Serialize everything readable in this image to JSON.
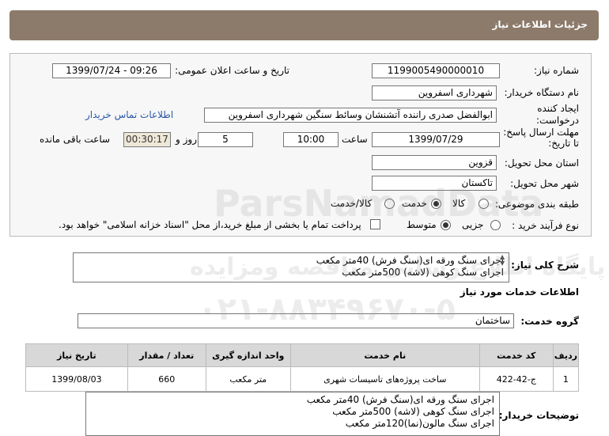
{
  "page_title": "جزئیات اطلاعات نیاز",
  "fields": {
    "need_number_label": "شماره نیاز:",
    "need_number": "1199005490000010",
    "announce_label": "تاریخ و ساعت اعلان عمومی:",
    "announce_value": "1399/07/24 - 09:26",
    "buyer_label": "نام دستگاه خریدار:",
    "buyer_value": "شهرداری اسفروین",
    "creator_label": "ایجاد کننده درخواست:",
    "creator_value": "ابوالفضل صدری راننده آتشنشان وسائط سنگین شهرداری اسفروین",
    "contact_link": "اطلاعات تماس خریدار",
    "deadline_label": "مهلت ارسال پاسخ: تا تاریخ:",
    "deadline_date": "1399/07/29",
    "time_label": "ساعت",
    "deadline_time": "10:00",
    "days_value": "5",
    "days_label": "روز و",
    "remaining_value": "00:30:17",
    "remaining_label": "ساعت باقی مانده",
    "province_label": "استان محل تحویل:",
    "province_value": "قزوین",
    "city_label": "شهر محل تحویل:",
    "city_value": "تاکستان",
    "category_label": "طبقه بندی موضوعی:",
    "category_options": [
      "کالا",
      "خدمت",
      "کالا/خدمت"
    ],
    "category_selected": 1,
    "process_label": "نوع فرآیند خرید :",
    "process_options": [
      "جزیی",
      "متوسط"
    ],
    "process_selected": 1,
    "payment_note": "پرداخت تمام یا بخشی از مبلغ خرید،از محل \"اسناد خزانه اسلامی\" خواهد بود."
  },
  "summary": {
    "label": "شرح کلی نیاز:",
    "lines": [
      "اجرای سنگ ورقه ای(سنگ فرش) 40متر مکعب",
      "اجرای سنگ کوهی (لاشه) 500متر مکعب"
    ]
  },
  "services_title": "اطلاعات خدمات مورد نیاز",
  "service_group_label": "گروه خدمت:",
  "service_group_value": "ساختمان",
  "table": {
    "headers": [
      "ردیف",
      "کد خدمت",
      "نام خدمت",
      "واحد اندازه گیری",
      "تعداد / مقدار",
      "تاریخ نیاز"
    ],
    "rows": [
      [
        "1",
        "ج-42-422",
        "ساخت پروژه‌های تاسیسات شهری",
        "متر مکعب",
        "660",
        "1399/08/03"
      ]
    ]
  },
  "buyer_notes": {
    "label": "توضیحات خریدار:",
    "lines": [
      "اجرای سنگ ورقه ای(سنگ فرش) 40متر مکعب",
      "اجرای سنگ کوهی (لاشه) 500متر مکعب",
      "اجرای سنگ مالون(نما)120متر مکعب"
    ]
  },
  "watermark": {
    "latin": "ParsNamadData",
    "persian": "پایگاه اطلاع رسانی مناقصه ومزایده",
    "phone": "۰۲۱-۸۸۳۴۹۶۷۰-۵"
  }
}
